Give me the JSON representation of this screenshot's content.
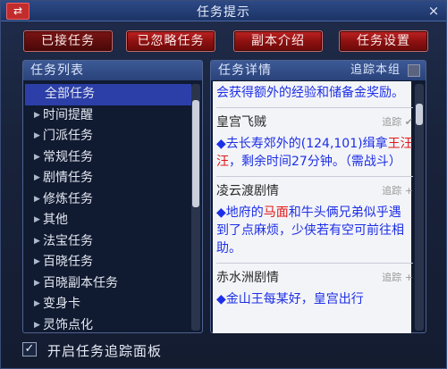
{
  "window": {
    "title": "任务提示"
  },
  "tabs": [
    "已接任务",
    "已忽略任务",
    "副本介绍",
    "任务设置"
  ],
  "task_list": {
    "header": "任务列表",
    "items": [
      "全部任务",
      "时间提醒",
      "门派任务",
      "常规任务",
      "剧情任务",
      "修炼任务",
      "其他",
      "法宝任务",
      "百晓任务",
      "百晓副本任务",
      "变身卡",
      "灵饰点化"
    ],
    "selected": "全部任务"
  },
  "task_detail": {
    "header": "任务详情",
    "track_group_label": "追踪本组",
    "intro_text": "会获得额外的经验和储备金奖励。",
    "entries": [
      {
        "title": "皇宫飞贼",
        "track_label": "追踪",
        "track_state": "check",
        "parts": [
          {
            "text": "◆去长寿郊外的(124,101)缉拿",
            "color": "blue"
          },
          {
            "text": "王汪汪",
            "color": "red"
          },
          {
            "text": "，剩余时间27分钟。（需战斗）",
            "color": "blue"
          }
        ]
      },
      {
        "title": "凌云渡剧情",
        "track_label": "追踪",
        "track_state": "plus",
        "parts": [
          {
            "text": "◆地府的",
            "color": "blue"
          },
          {
            "text": "马面",
            "color": "red"
          },
          {
            "text": "和牛头俩兄弟似乎遇到了点麻烦，少侠若有空可前往相助。",
            "color": "blue"
          }
        ]
      },
      {
        "title": "赤水洲剧情",
        "track_label": "追踪",
        "track_state": "plus",
        "parts": [
          {
            "text": "◆金山王每某好，皇宫出行",
            "color": "blue"
          }
        ]
      }
    ]
  },
  "footer": {
    "checkbox_label": "开启任务追踪面板",
    "checked": true
  },
  "colors": {
    "tab_red": "#c02222",
    "panel_header": "#2a427a",
    "selected_row": "#2c3fa8",
    "detail_blue": "#1d2fe6",
    "detail_red": "#e01818"
  }
}
